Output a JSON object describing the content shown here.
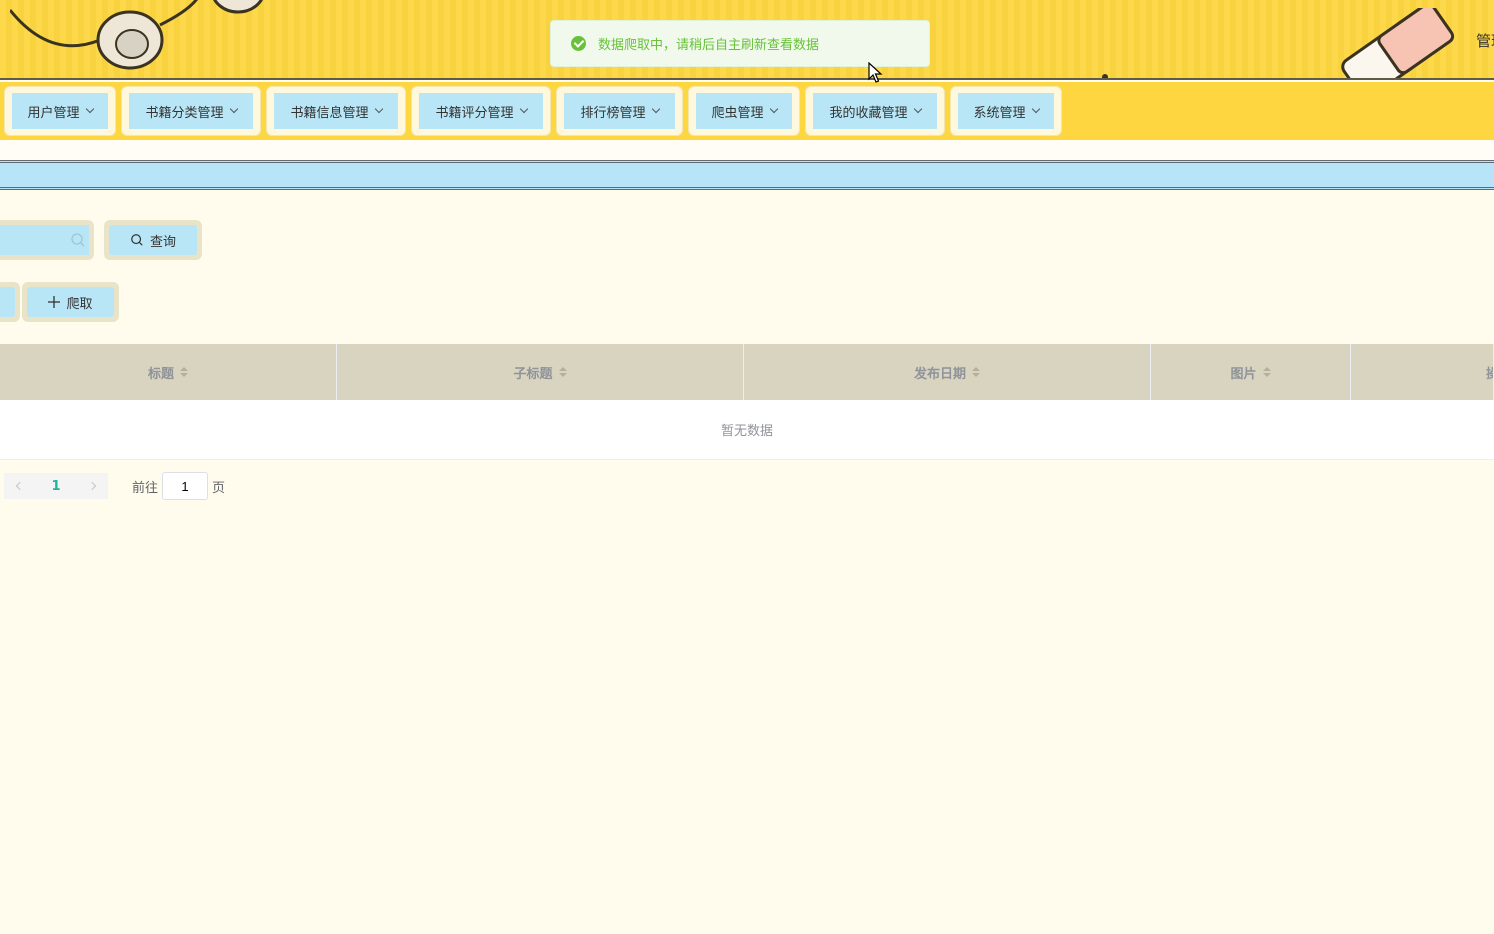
{
  "header": {
    "right_text": "管理"
  },
  "toast": {
    "message": "数据爬取中，请稍后自主刷新查看数据",
    "color": "#67c23a"
  },
  "nav": {
    "items": [
      {
        "label": "用户管理"
      },
      {
        "label": "书籍分类管理"
      },
      {
        "label": "书籍信息管理"
      },
      {
        "label": "书籍评分管理"
      },
      {
        "label": "排行榜管理"
      },
      {
        "label": "爬虫管理"
      },
      {
        "label": "我的收藏管理"
      },
      {
        "label": "系统管理"
      }
    ]
  },
  "search": {
    "placeholder": "",
    "query_label": "查询"
  },
  "actions": {
    "crawl_label": "爬取"
  },
  "table": {
    "columns": [
      "标题",
      "子标题",
      "发布日期",
      "图片",
      "操"
    ],
    "empty_text": "暂无数据"
  },
  "pagination": {
    "current_page": "1",
    "goto_label": "前往",
    "goto_value": "1",
    "page_suffix": "页"
  },
  "colors": {
    "header": "#fdd640",
    "accent_blue": "#b9e6f6",
    "page_bg": "#fffcee"
  }
}
